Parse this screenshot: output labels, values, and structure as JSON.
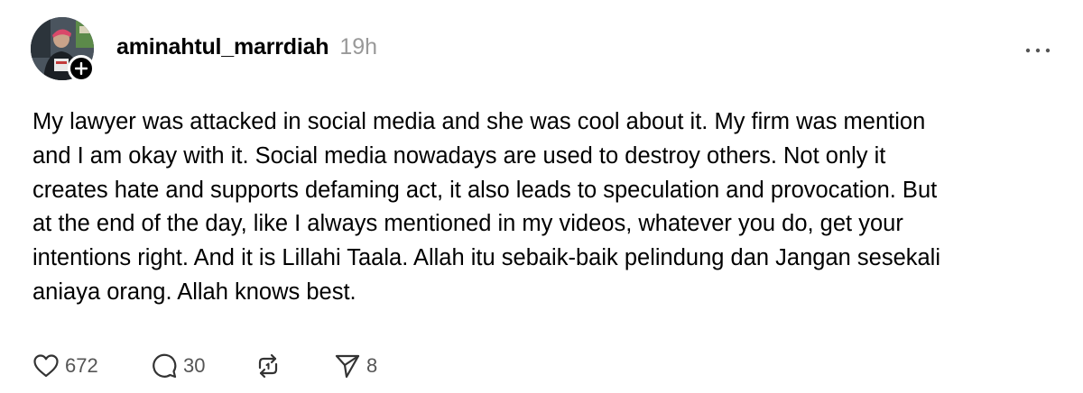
{
  "post": {
    "author": {
      "username": "aminahtul_marrdiah",
      "avatar_icon": "profile-photo",
      "follow_icon": "plus-icon"
    },
    "timestamp": "19h",
    "more_icon": "ellipsis-icon",
    "body_lines": [
      "My lawyer was attacked in social media and she was cool about it. My firm was mention",
      "and I am okay with it. Social media nowadays are used to destroy others. Not only it",
      "creates hate and supports defaming act, it also leads to speculation and provocation. But",
      "at the end of the day, like I always mentioned in my videos, whatever you do, get your",
      "intentions right. And it is Lillahi Taala. Allah itu sebaik-baik pelindung dan Jangan sesekali",
      "aniaya orang. Allah knows best."
    ],
    "actions": {
      "like": {
        "icon": "heart-icon",
        "count": "672"
      },
      "reply": {
        "icon": "comment-icon",
        "count": "30"
      },
      "repost": {
        "icon": "repost-icon",
        "count": ""
      },
      "share": {
        "icon": "send-icon",
        "count": "8"
      }
    }
  },
  "colors": {
    "text": "#000000",
    "muted": "#999999",
    "icon": "#333333",
    "background": "#ffffff"
  }
}
